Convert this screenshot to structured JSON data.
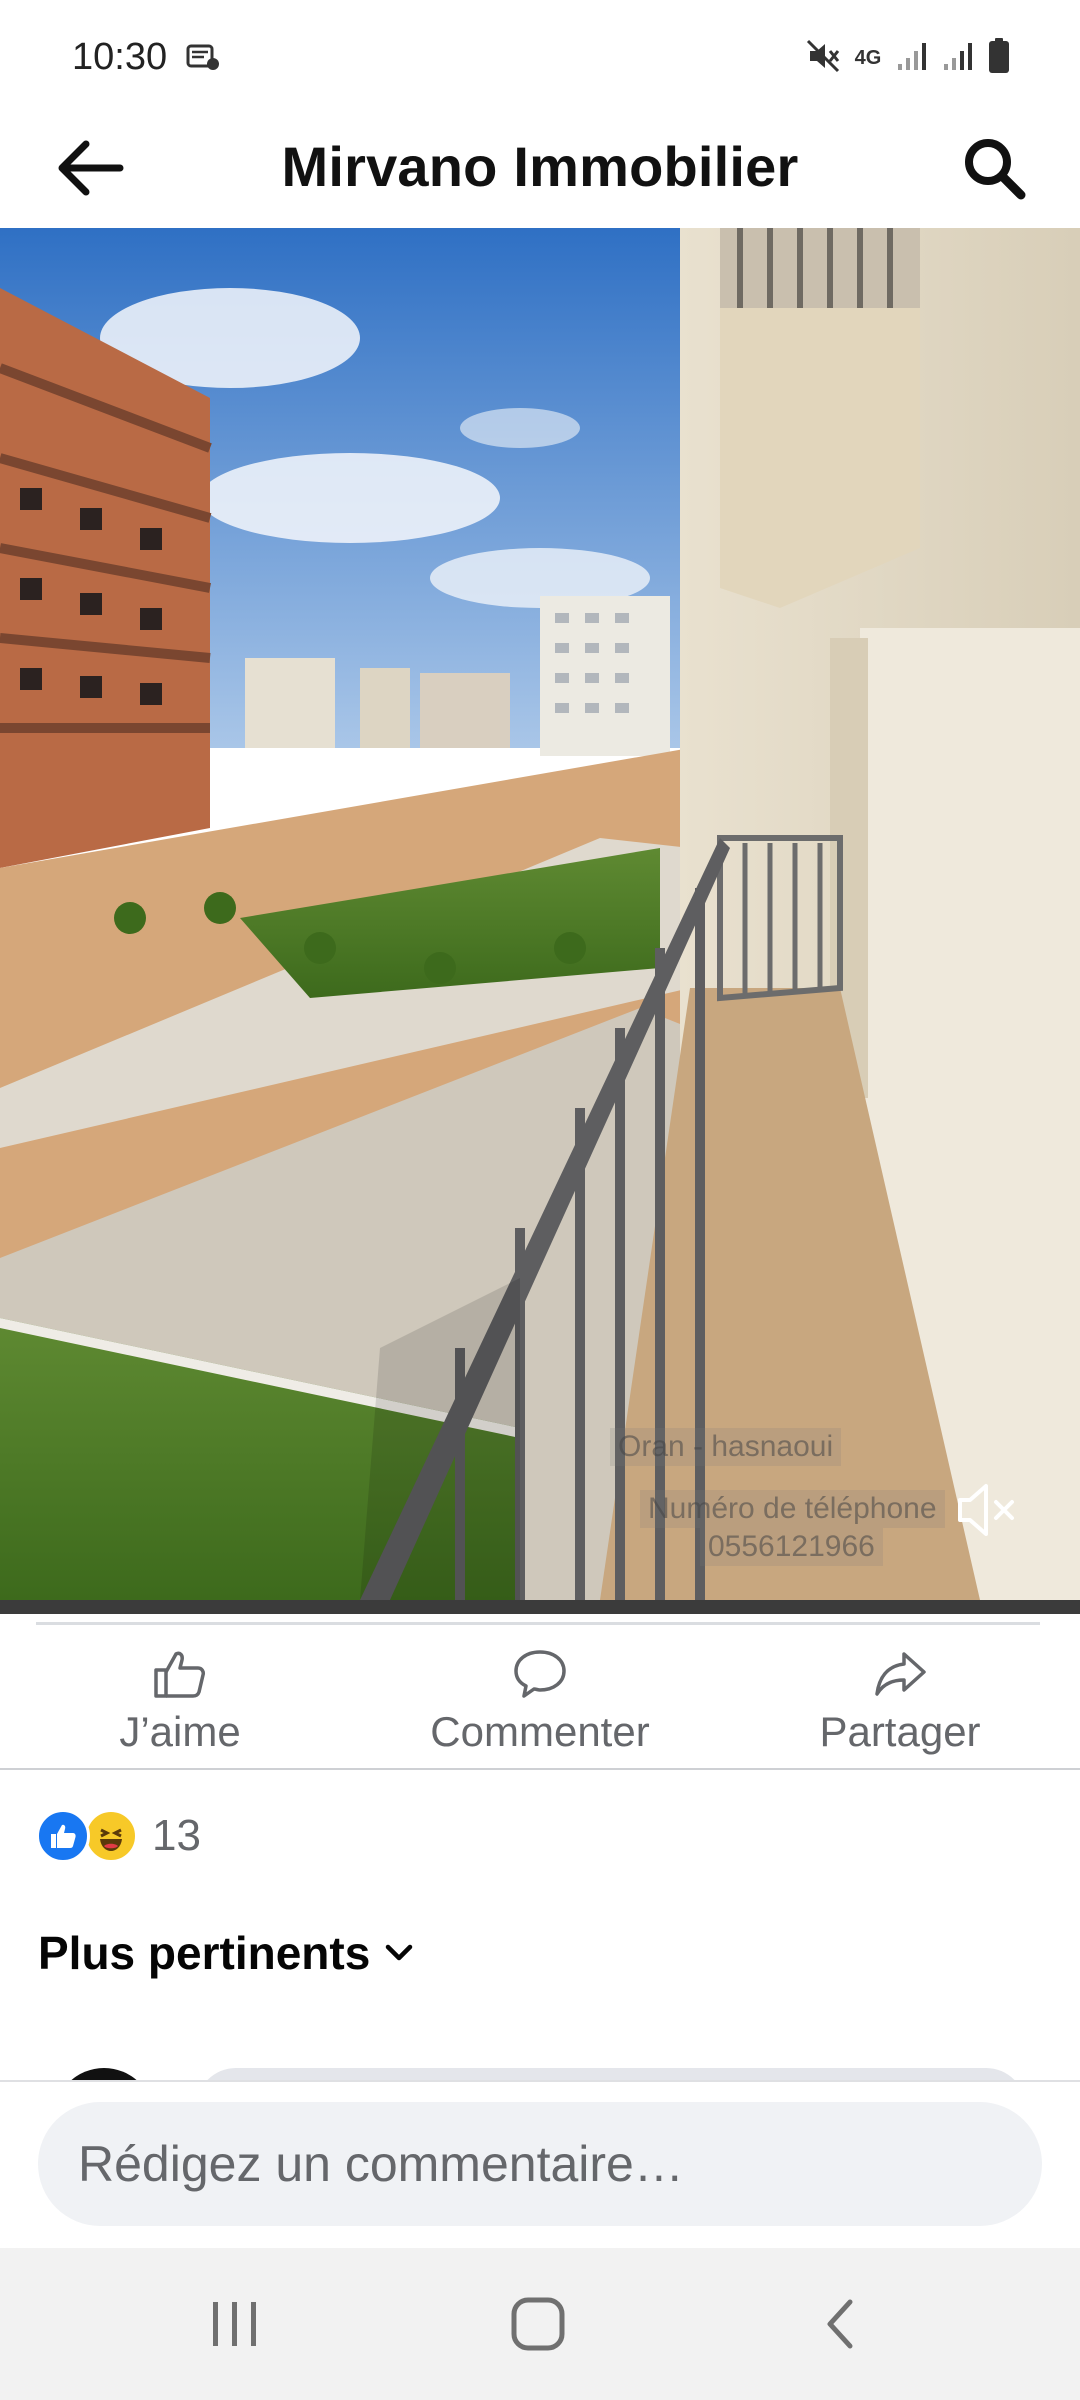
{
  "status_bar": {
    "time": "10:30",
    "network": "4G",
    "icons": [
      "notification-icon",
      "mute-icon",
      "signal-icon",
      "signal-icon",
      "battery-icon"
    ]
  },
  "header": {
    "title": "Mirvano Immobilier",
    "back_icon": "arrow-left-icon",
    "search_icon": "search-icon"
  },
  "media": {
    "watermark": [
      "Oran - hasnaoui",
      "Numéro de téléphone",
      "0556121966"
    ],
    "mute_icon": "volume-muted-icon"
  },
  "actions": [
    {
      "label": "J’aime",
      "icon": "thumbs-up-icon"
    },
    {
      "label": "Commenter",
      "icon": "comment-icon"
    },
    {
      "label": "Partager",
      "icon": "share-icon"
    }
  ],
  "reactions": {
    "icons": [
      "like-reaction-icon",
      "haha-reaction-icon"
    ],
    "count": "13"
  },
  "comments": {
    "sort_label": "Plus pertinents",
    "composer_placeholder": "Rédigez un commentaire…"
  },
  "colors": {
    "brand_blue": "#1877f2",
    "secondary_text": "#65676b",
    "composer_bg": "#f0f2f5"
  }
}
